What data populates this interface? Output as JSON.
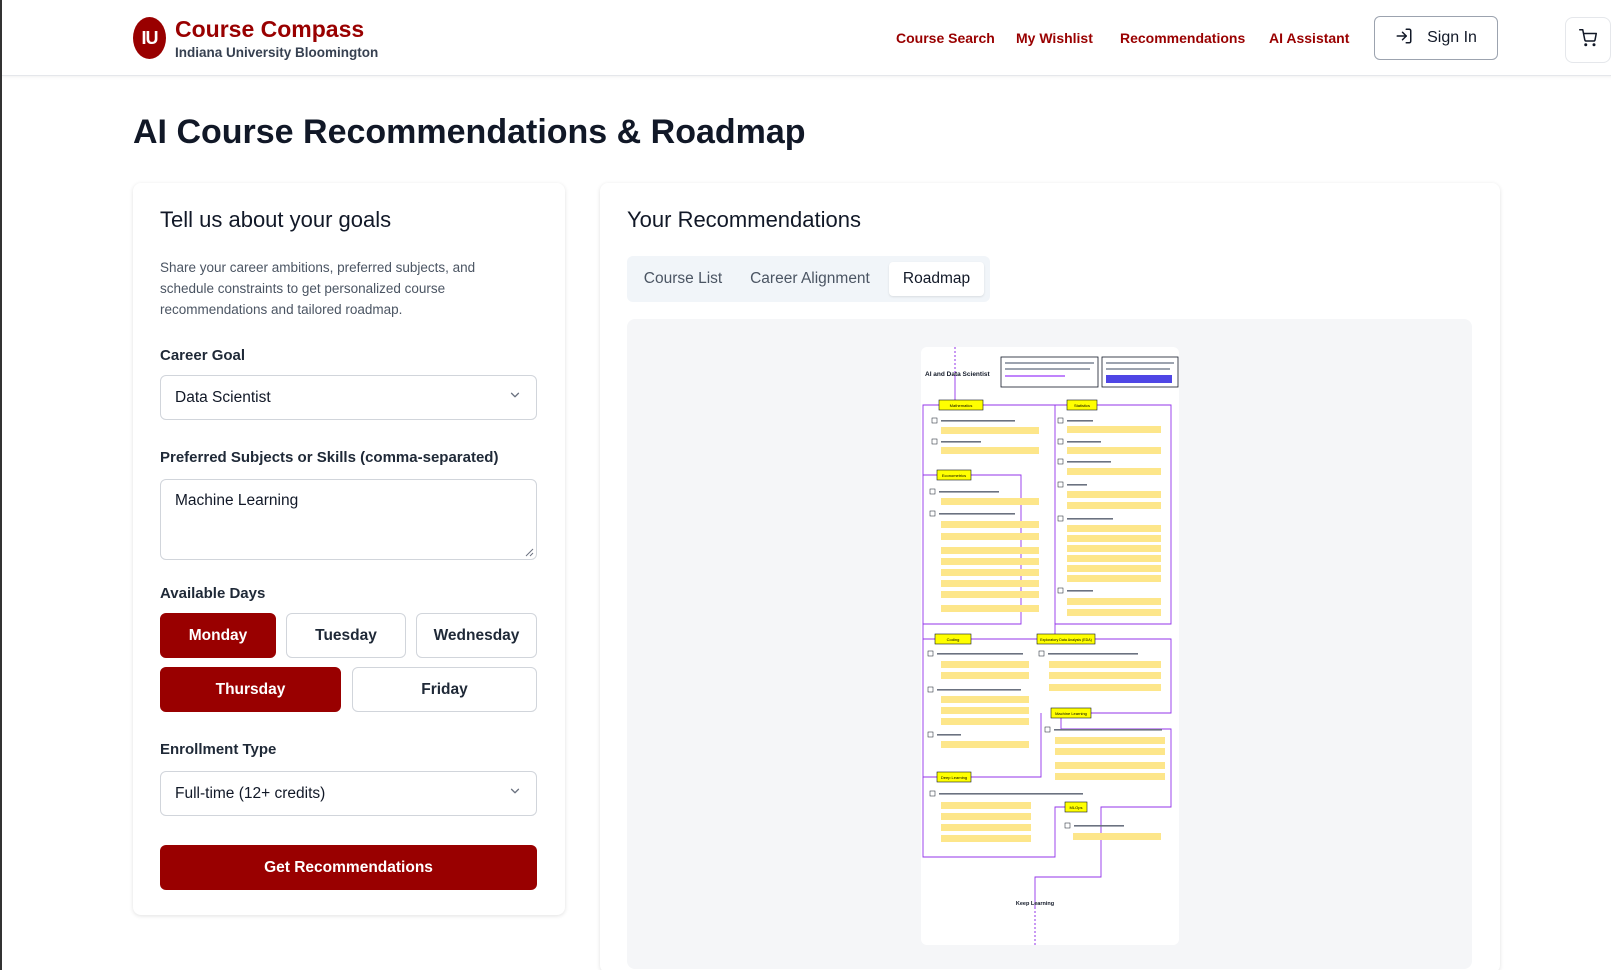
{
  "brand": {
    "logo": "IU",
    "title": "Course Compass",
    "subtitle": "Indiana University Bloomington"
  },
  "nav": {
    "links": [
      "Course Search",
      "My Wishlist",
      "Recommendations",
      "AI Assistant"
    ],
    "sign_in": "Sign In"
  },
  "page": {
    "title": "AI Course Recommendations & Roadmap"
  },
  "goals_form": {
    "heading": "Tell us about your goals",
    "description": "Share your career ambitions, preferred subjects, and schedule constraints to get personalized course recommendations and tailored roadmap.",
    "career_goal": {
      "label": "Career Goal",
      "value": "Data Scientist"
    },
    "subjects": {
      "label": "Preferred Subjects or Skills (comma-separated)",
      "value": "Machine Learning"
    },
    "days": {
      "label": "Available Days",
      "options": [
        {
          "label": "Monday",
          "selected": true
        },
        {
          "label": "Tuesday",
          "selected": false
        },
        {
          "label": "Wednesday",
          "selected": false
        },
        {
          "label": "Thursday",
          "selected": true
        },
        {
          "label": "Friday",
          "selected": false
        }
      ]
    },
    "enrollment": {
      "label": "Enrollment Type",
      "value": "Full-time (12+ credits)"
    },
    "submit": "Get Recommendations"
  },
  "recommendations": {
    "heading": "Your Recommendations",
    "tabs": [
      {
        "label": "Course List",
        "active": false
      },
      {
        "label": "Career Alignment",
        "active": false
      },
      {
        "label": "Roadmap",
        "active": true
      }
    ],
    "roadmap": {
      "title": "AI and Data Scientist",
      "sections": [
        "Mathematics",
        "Statistics",
        "Econometrics",
        "Coding",
        "Exploratory Data Analysis (EDA)",
        "Machine Learning",
        "Deep Learning",
        "MLOps"
      ],
      "end_label": "Keep Learning"
    }
  },
  "colors": {
    "brand": "#990000",
    "muted_bg": "#f1f5f9",
    "node_yellow": "#ffff00",
    "path_purple": "#9333ea"
  }
}
